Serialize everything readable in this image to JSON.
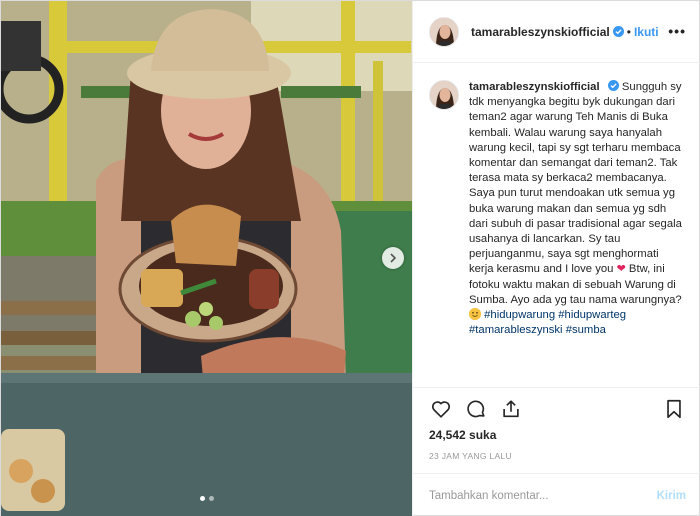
{
  "post": {
    "username": "tamarableszynskiofficial",
    "separator": "•",
    "follow_label": "Ikuti",
    "more_label": "•••",
    "caption": {
      "part1": "Sungguh sy tdk menyangka begitu byk dukungan dari teman2 agar warung Teh Manis di Buka kembali. Walau warung saya hanyalah warung kecil, tapi sy sgt terharu membaca komentar dan semangat dari teman2. Tak terasa mata sy berkaca2 membacanya. Saya pun turut mendoakan utk semua yg buka warung makan dan semua yg sdh dari subuh di pasar tradisional agar segala usahanya di lancarkan. Sy tau perjuanganmu, saya sgt menghormati kerja kerasmu and I love you ",
      "part2": " Btw, ini fotoku waktu makan di sebuah Warung di Sumba. Ayo ada yg tau nama warungnya? ",
      "hashtags": "#hidupwarung #hidupwarteg #tamarableszynski #sumba",
      "heart_emoji": "❤",
      "smile_emoji": "smiling-face-emoji"
    },
    "likes": "24,542 suka",
    "timestamp": "23 JAM YANG LALU",
    "comment_placeholder": "Tambahkan komentar...",
    "post_button_label": "Kirim",
    "carousel": {
      "slide_count": 2,
      "active_slide": 1
    },
    "icons": {
      "verified": "verified-badge-icon",
      "like": "heart-icon",
      "comment": "comment-bubble-icon",
      "share": "share-icon",
      "save": "bookmark-icon",
      "next": "chevron-right-icon"
    },
    "colors": {
      "link_blue": "#3897f0",
      "hashtag_blue": "#003569",
      "muted_gray": "#999999",
      "post_button_disabled": "#b2dffc"
    }
  }
}
